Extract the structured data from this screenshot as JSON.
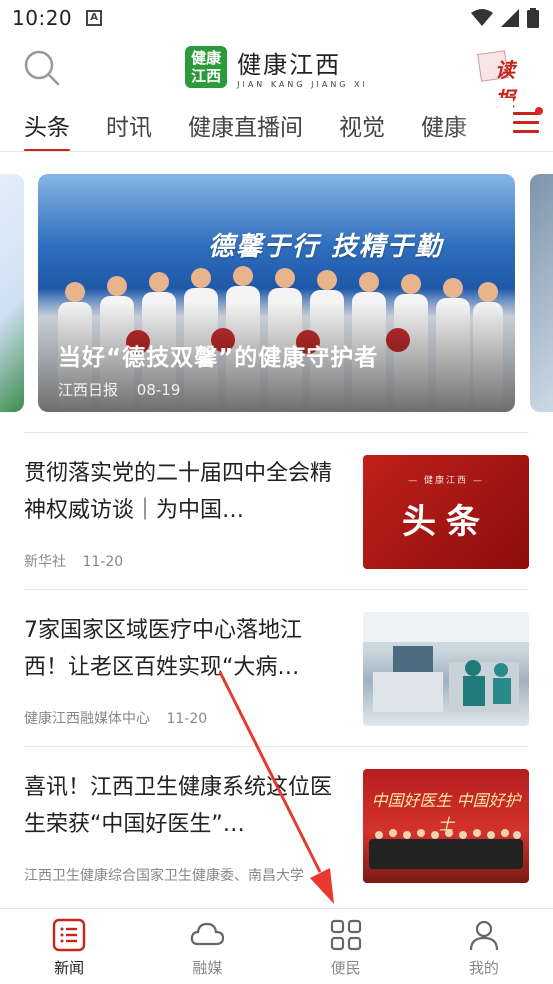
{
  "status_bar": {
    "time": "10:20",
    "notif_icon": "A"
  },
  "header": {
    "logo_box": "健康\n江西",
    "logo_cn": "健康江西",
    "logo_en": "JIAN KANG JIANG XI",
    "read_label": "读报"
  },
  "tabs": [
    "头条",
    "时讯",
    "健康直播间",
    "视觉",
    "健康"
  ],
  "carousel": {
    "banner_text": "德馨于行 技精于勤",
    "title": "当好“德技双馨”的健康守护者",
    "source": "江西日报",
    "date": "08-19"
  },
  "news": [
    {
      "title": "贯彻落实党的二十届四中全会精神权威访谈｜为中国…",
      "source": "新华社",
      "date": "11-20",
      "thumb_small": "— 健康江西 —",
      "thumb_big": "头条"
    },
    {
      "title": "7家国家区域医疗中心落地江西！让老区百姓实现“大病…",
      "source": "健康江西融媒体中心",
      "date": "11-20"
    },
    {
      "title": "喜讯！江西卫生健康系统这位医生荣获“中国好医生”…",
      "source": "江西卫生健康综合国家卫生健康委、南昌大学",
      "date": "",
      "thumb_caption": "中国好医生 中国好护士"
    }
  ],
  "bottom_nav": [
    {
      "label": "新闻",
      "icon": "news-list-icon",
      "active": true
    },
    {
      "label": "融媒",
      "icon": "cloud-icon",
      "active": false
    },
    {
      "label": "便民",
      "icon": "grid-icon",
      "active": false
    },
    {
      "label": "我的",
      "icon": "person-icon",
      "active": false
    }
  ],
  "colors": {
    "accent": "#c7241b",
    "logo_green": "#2d9a3a",
    "annotation_arrow": "#e8392f"
  }
}
